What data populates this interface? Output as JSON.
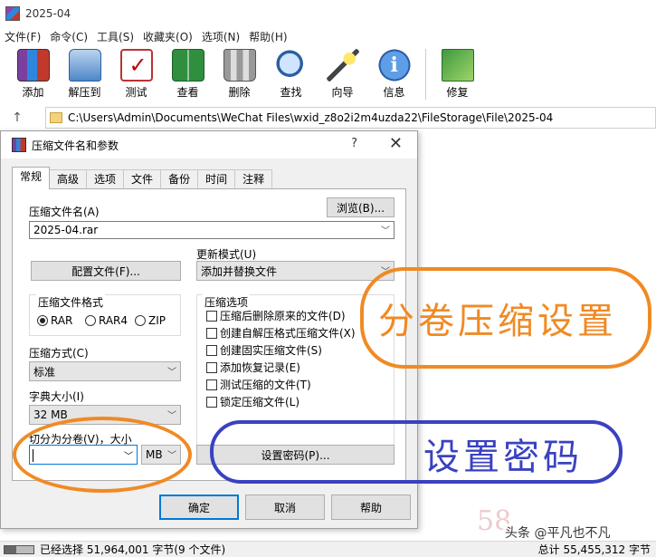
{
  "window": {
    "title": "2025-04"
  },
  "menu": [
    "文件(F)",
    "命令(C)",
    "工具(S)",
    "收藏夹(O)",
    "选项(N)",
    "帮助(H)"
  ],
  "toolbar": {
    "add": "添加",
    "extract": "解压到",
    "test": "测试",
    "view": "查看",
    "delete": "删除",
    "find": "查找",
    "wizard": "向导",
    "info": "信息",
    "repair": "修复"
  },
  "address": {
    "up": "↑",
    "path": "C:\\Users\\Admin\\Documents\\WeChat Files\\wxid_z8o2i2m4uzda22\\FileStorage\\File\\2025-04"
  },
  "dialog": {
    "title": "压缩文件名和参数",
    "help": "?",
    "close": "✕",
    "tabs": [
      "常规",
      "高级",
      "选项",
      "文件",
      "备份",
      "时间",
      "注释"
    ],
    "archive_name_label": "压缩文件名(A)",
    "archive_name": "2025-04.rar",
    "browse": "浏览(B)...",
    "profiles": "配置文件(F)...",
    "update_mode_label": "更新模式(U)",
    "update_mode": "添加并替换文件",
    "format_label": "压缩文件格式",
    "formats": [
      "RAR",
      "RAR4",
      "ZIP"
    ],
    "options_label": "压缩选项",
    "options": [
      "压缩后删除原来的文件(D)",
      "创建自解压格式压缩文件(X)",
      "创建固实压缩文件(S)",
      "添加恢复记录(E)",
      "测试压缩的文件(T)",
      "锁定压缩文件(L)"
    ],
    "method_label": "压缩方式(C)",
    "method": "标准",
    "dict_label": "字典大小(I)",
    "dict": "32 MB",
    "split_label": "切分为分卷(V)，大小",
    "split_value": "",
    "split_unit": "MB",
    "password": "设置密码(P)...",
    "ok": "确定",
    "cancel": "取消",
    "help_btn": "帮助"
  },
  "annotations": {
    "split_settings": "分卷压缩设置",
    "set_password": "设置密码"
  },
  "status": {
    "left": "已经选择 51,964,001 字节(9 个文件)",
    "right": "总计 55,455,312 字节"
  },
  "watermark": "58",
  "credit": "头条 @平凡也不凡",
  "colors": {
    "annotation_orange": "#f08a24",
    "annotation_blue": "#3a42c0",
    "focus_blue": "#0078d7"
  }
}
